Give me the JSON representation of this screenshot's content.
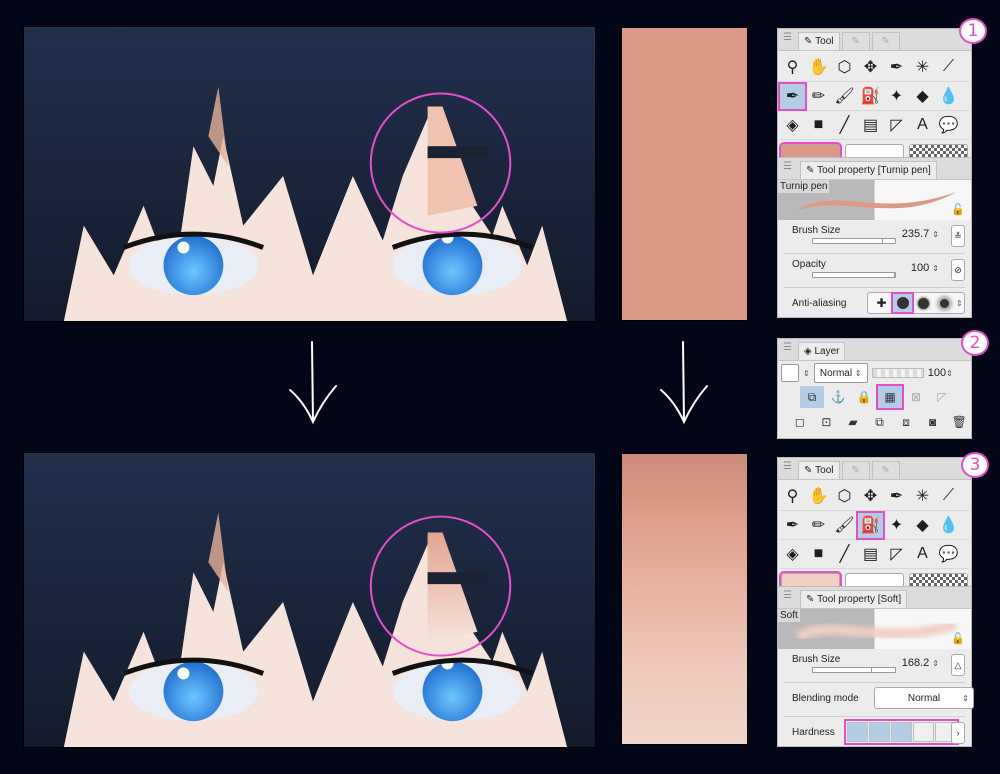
{
  "before": {
    "artwork": {
      "description": "anime eyes close-up with dark blue hair",
      "hair_color": "#1b2234",
      "skin_color": "#f6e3dc",
      "iris_color": "#2c8fe6"
    },
    "swatch": {
      "color": "#dc9986"
    },
    "highlight_circle_color": "#e64ec8"
  },
  "after": {
    "artwork": {
      "description": "anime eyes close-up with blended skin shading",
      "hair_color": "#1b2234",
      "skin_color": "#f6e3dc",
      "iris_color": "#2c8fe6"
    },
    "swatch": {
      "gradient_top": "#cd8c7a",
      "gradient_bottom": "#f0d5cb"
    }
  },
  "arrows": [
    {
      "icon": "arrow-down-icon"
    },
    {
      "icon": "arrow-down-icon"
    }
  ],
  "steps": [
    "1",
    "2",
    "3"
  ],
  "panel1": {
    "tabs": [
      {
        "label": "Tool",
        "icon": "pen-icon"
      },
      {
        "label": "",
        "icon": "sub-tool-icon"
      },
      {
        "label": "",
        "icon": "sub-tool-icon"
      }
    ],
    "tools_row1": [
      "zoom-icon",
      "hand-icon",
      "object-icon",
      "move-icon",
      "lasso-pen-icon",
      "magic-wand-icon",
      "eyedropper-icon"
    ],
    "tools_row2": [
      "pen-icon",
      "pencil-icon",
      "brush-icon",
      "airbrush-icon",
      "decoration-icon",
      "eraser-icon",
      "blend-icon"
    ],
    "tools_row3": [
      "fill-icon",
      "gradient-icon",
      "figure-icon",
      "frame-icon",
      "ruler-icon",
      "text-icon",
      "balloon-icon",
      "correct-line-icon"
    ],
    "selected_tool": "pen-icon",
    "main_color": "#dc9986",
    "sub_color": "#ffffff",
    "property_title": "Tool property [Turnip pen]",
    "brush_name": "Turnip pen",
    "brush_size_label": "Brush Size",
    "brush_size_value": "235.7",
    "brush_size_fraction": 0.85,
    "opacity_label": "Opacity",
    "opacity_value": "100",
    "opacity_fraction": 1.0,
    "anti_aliasing_label": "Anti-aliasing",
    "anti_aliasing_selected": "weak"
  },
  "panel2": {
    "tab_label": "Layer",
    "blend_mode": "Normal",
    "opacity_value": "100",
    "icons": [
      "clip-to-layer-below-icon",
      "reference-layer-icon",
      "lock-layer-icon",
      "lock-transparent-pixels-icon",
      "mask-off-icon",
      "ruler-off-icon"
    ],
    "active_icons": [
      "clip-to-layer-below-icon",
      "lock-transparent-pixels-icon"
    ],
    "bottom_icons": [
      "new-raster-layer-icon",
      "new-vector-layer-icon",
      "new-folder-icon",
      "transfer-down-icon",
      "merge-down-icon",
      "create-mask-icon",
      "delete-layer-icon"
    ]
  },
  "panel3": {
    "tabs": [
      {
        "label": "Tool",
        "icon": "pen-icon"
      },
      {
        "label": "",
        "icon": "sub-tool-icon"
      },
      {
        "label": "",
        "icon": "sub-tool-icon"
      }
    ],
    "selected_tool": "airbrush-icon",
    "main_color": "#f1cfc3",
    "sub_color": "#ffffff",
    "property_title": "Tool property [Soft]",
    "brush_name": "Soft",
    "brush_size_label": "Brush Size",
    "brush_size_value": "168.2",
    "brush_size_fraction": 0.72,
    "blending_mode_label": "Blending mode",
    "blending_mode_value": "Normal",
    "hardness_label": "Hardness",
    "hardness_level": 3,
    "hardness_max": 5
  }
}
